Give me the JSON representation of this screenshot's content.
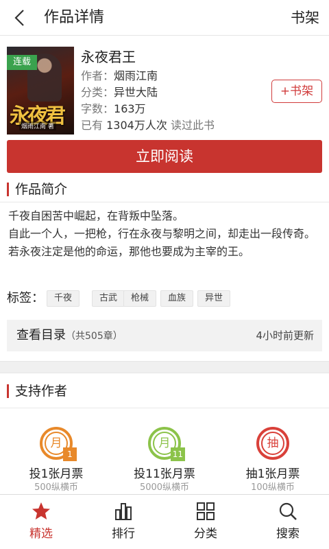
{
  "header": {
    "title": "作品详情",
    "shelf_link": "书架"
  },
  "book": {
    "status_tag": "连载",
    "cover_title": "永夜君王",
    "cover_author": "烟雨江南 著",
    "name": "永夜君王",
    "author_label": "作者：",
    "author": "烟雨江南",
    "category_label": "分类：",
    "category": "异世大陆",
    "word_count_label": "字数：",
    "word_count": "163万",
    "readers_prefix": "已有",
    "readers_count": "1304万人次",
    "readers_suffix": "读过此书",
    "add_shelf": "+书架",
    "read_now": "立即阅读"
  },
  "intro": {
    "heading": "作品简介",
    "lines": [
      "千夜自困苦中崛起，在背叛中坠落。",
      "自此一个人，一把枪，行在永夜与黎明之间，却走出一段传奇。",
      "若永夜注定是他的命运，那他也要成为主宰的王。"
    ]
  },
  "tags": {
    "label": "标签：",
    "items": [
      "千夜",
      "古武",
      "枪械",
      "血族",
      "异世"
    ]
  },
  "toc": {
    "label": "查看目录",
    "count": "（共505章）",
    "updated": "4小时前更新"
  },
  "support": {
    "heading": "支持作者",
    "votes": [
      {
        "glyph": "月",
        "corner": "1",
        "label": "投1张月票",
        "cost": "500纵横币",
        "color": "#e8892a"
      },
      {
        "glyph": "月",
        "corner": "11",
        "label": "投11张月票",
        "cost": "5000纵横币",
        "color": "#8cc34a"
      },
      {
        "glyph": "抽",
        "corner": "",
        "label": "抽1张月票",
        "cost": "100纵横币",
        "color": "#d9413a"
      }
    ]
  },
  "tabbar": {
    "items": [
      {
        "label": "精选",
        "icon": "star-icon",
        "active": true
      },
      {
        "label": "排行",
        "icon": "bar-chart-icon",
        "active": false
      },
      {
        "label": "分类",
        "icon": "grid-icon",
        "active": false
      },
      {
        "label": "搜索",
        "icon": "search-icon",
        "active": false
      }
    ]
  },
  "colors": {
    "accent": "#c8342f",
    "serial_tag": "#3aa24e"
  }
}
